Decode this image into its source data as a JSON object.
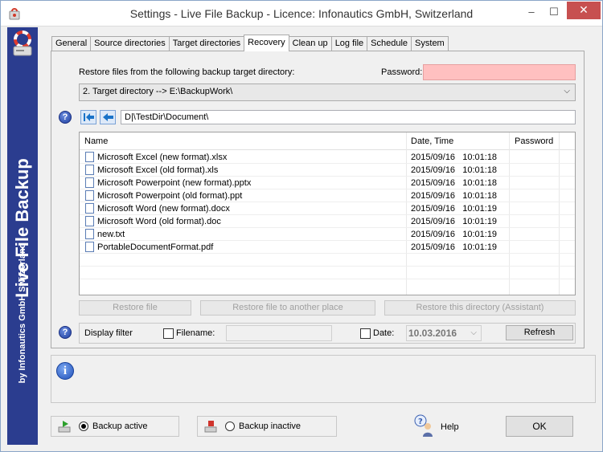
{
  "window": {
    "title": "Settings - Live File Backup - Licence: Infonautics GmbH, Switzerland",
    "minimize": "–",
    "maximize": "☐",
    "close": "✕"
  },
  "sidebar": {
    "title": "Live File Backup",
    "subtitle": "by Infonautics GmbH Switzerland"
  },
  "tabs": [
    "General",
    "Source directories",
    "Target directories",
    "Recovery",
    "Clean up",
    "Log file",
    "Schedule",
    "System"
  ],
  "active_tab": "Recovery",
  "recovery": {
    "restore_label": "Restore files from the following backup target directory:",
    "password_label": "Password:",
    "password_value": "",
    "target_select": "2. Target directory --> E:\\BackupWork\\",
    "path": "D|\\TestDir\\Document\\",
    "columns": [
      "Name",
      "Date, Time",
      "Password"
    ],
    "files": [
      {
        "name": "Microsoft Excel (new format).xlsx",
        "date": "2015/09/16",
        "time": "10:01:18"
      },
      {
        "name": "Microsoft Excel (old format).xls",
        "date": "2015/09/16",
        "time": "10:01:18"
      },
      {
        "name": "Microsoft Powerpoint (new format).pptx",
        "date": "2015/09/16",
        "time": "10:01:18"
      },
      {
        "name": "Microsoft Powerpoint (old format).ppt",
        "date": "2015/09/16",
        "time": "10:01:18"
      },
      {
        "name": "Microsoft Word (new format).docx",
        "date": "2015/09/16",
        "time": "10:01:19"
      },
      {
        "name": "Microsoft Word (old format).doc",
        "date": "2015/09/16",
        "time": "10:01:19"
      },
      {
        "name": "new.txt",
        "date": "2015/09/16",
        "time": "10:01:19"
      },
      {
        "name": "PortableDocumentFormat.pdf",
        "date": "2015/09/16",
        "time": "10:01:19"
      }
    ],
    "buttons": {
      "restore_file": "Restore file",
      "restore_other": "Restore file to another place",
      "restore_dir": "Restore this directory (Assistant)"
    },
    "filter": {
      "label": "Display filter",
      "filename_label": "Filename:",
      "filename_value": "",
      "date_label": "Date:",
      "date_value": "10.03.2016",
      "refresh": "Refresh"
    }
  },
  "footer": {
    "backup_active": "Backup active",
    "backup_inactive": "Backup inactive",
    "help": "Help",
    "ok": "OK"
  },
  "colors": {
    "sidebar": "#2b3d8f",
    "password_bg": "#ffc0c0",
    "close_button": "#c75050"
  }
}
